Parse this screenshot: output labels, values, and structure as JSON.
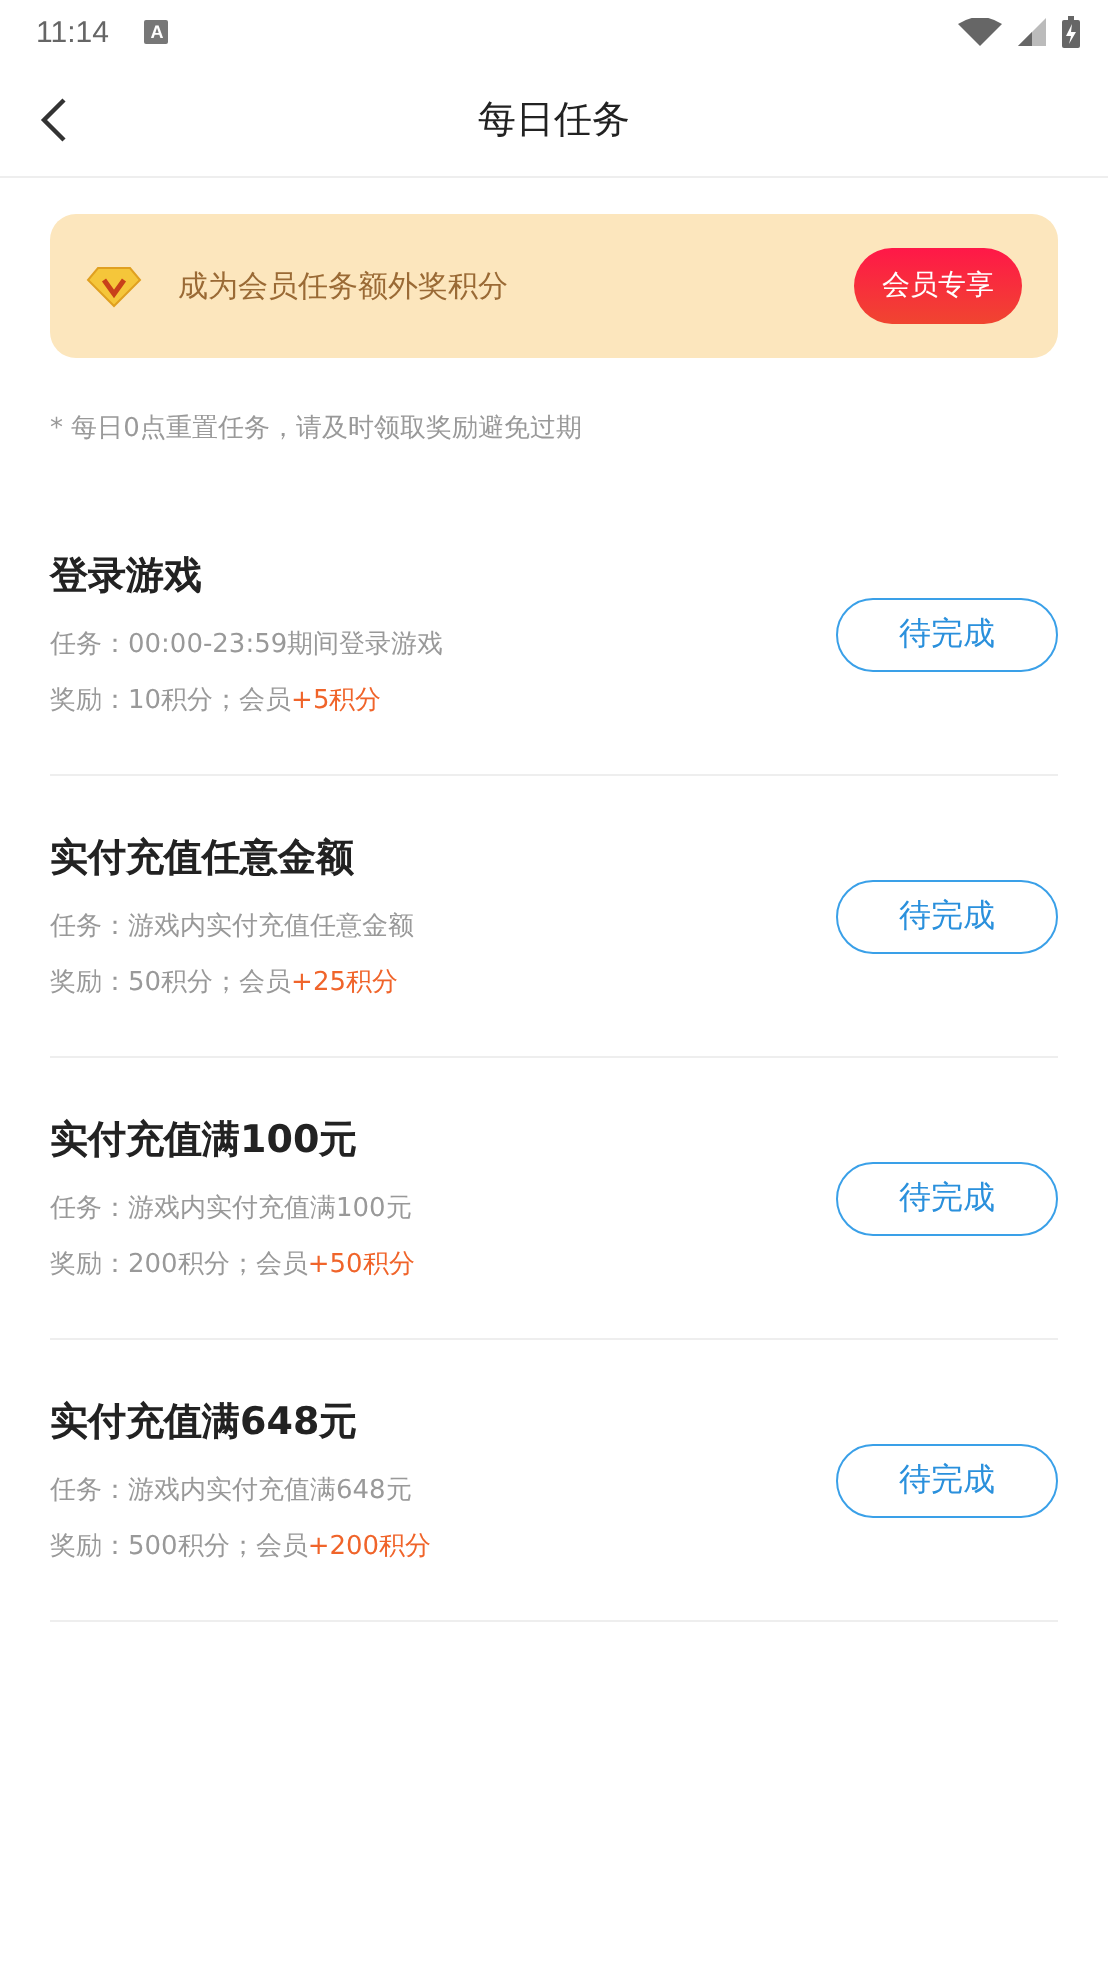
{
  "status_bar": {
    "time": "11:14",
    "notification_letter": "A"
  },
  "header": {
    "title": "每日任务"
  },
  "banner": {
    "text": "成为会员任务额外奖积分",
    "button": "会员专享"
  },
  "note": "* 每日0点重置任务，请及时领取奖励避免过期",
  "tasks": [
    {
      "title": "登录游戏",
      "task": "任务：00:00-23:59期间登录游戏",
      "reward": "奖励：10积分；会员",
      "bonus": "+5积分",
      "status": "待完成",
      "completed": false
    },
    {
      "title": "实付充值任意金额",
      "task": "任务：游戏内实付充值任意金额",
      "reward": "奖励：50积分；会员",
      "bonus": "+25积分",
      "status": "待完成",
      "completed": false
    },
    {
      "title": "实付充值满100元",
      "task": "任务：游戏内实付充值满100元",
      "reward": "奖励：200积分；会员",
      "bonus": "+50积分",
      "status": "待完成",
      "completed": false
    },
    {
      "title": "实付充值满648元",
      "task": "任务：游戏内实付充值满648元",
      "reward": "奖励：500积分；会员",
      "bonus": "+200积分",
      "status": "待完成",
      "completed": false
    }
  ]
}
